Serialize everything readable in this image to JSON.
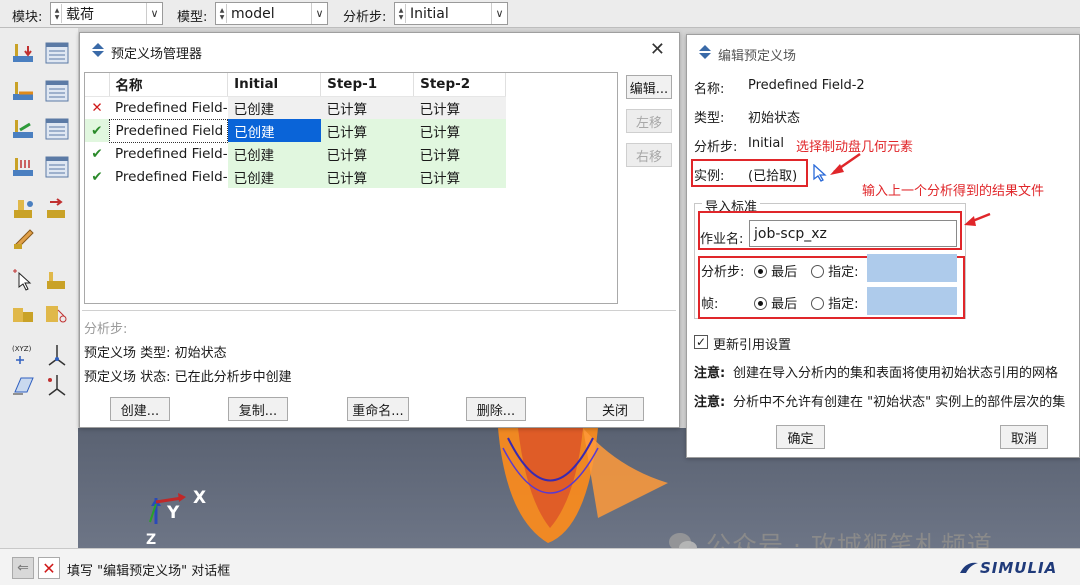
{
  "topbar": {
    "module_label": "模块:",
    "module_value": "载荷",
    "model_label": "模型:",
    "model_value": "model",
    "step_label": "分析步:",
    "step_value": "Initial"
  },
  "manager": {
    "title": "预定义场管理器",
    "columns": [
      "名称",
      "Initial",
      "Step-1",
      "Step-2"
    ],
    "rows": [
      {
        "status": "✕",
        "name": "Predefined Field-",
        "initial": "已创建",
        "step1": "已计算",
        "step2": "已计算"
      },
      {
        "status": "✔",
        "name": "Predefined Field",
        "initial": "已创建",
        "step1": "已计算",
        "step2": "已计算"
      },
      {
        "status": "✔",
        "name": "Predefined Field-",
        "initial": "已创建",
        "step1": "已计算",
        "step2": "已计算"
      },
      {
        "status": "✔",
        "name": "Predefined Field-",
        "initial": "已创建",
        "step1": "已计算",
        "step2": "已计算"
      }
    ],
    "side_buttons": {
      "edit": "编辑...",
      "left": "左移",
      "right": "右移"
    },
    "info_step_label": "分析步:",
    "info_type": "预定义场 类型: 初始状态",
    "info_status": "预定义场 状态: 已在此分析步中创建",
    "buttons": {
      "create": "创建...",
      "copy": "复制...",
      "rename": "重命名...",
      "delete": "删除...",
      "close": "关闭"
    }
  },
  "editor": {
    "title": "编辑预定义场",
    "name_label": "名称:",
    "name_value": "Predefined Field-2",
    "type_label": "类型:",
    "type_value": "初始状态",
    "step_label": "分析步:",
    "step_value": "Initial",
    "instance_label": "实例:",
    "instance_value": "(已拾取)",
    "group_title": "导入标准",
    "job_label": "作业名:",
    "job_value": "job-scp_xz",
    "step_row_label": "分析步:",
    "frame_row_label": "帧:",
    "last_label": "最后",
    "specify_label": "指定:",
    "update_label": "更新引用设置",
    "note1_label": "注意:",
    "note1_text": "创建在导入分析内的集和表面将使用初始状态引用的网格",
    "note2_label": "注意:",
    "note2_text": "分析中不允许有创建在 \"初始状态\" 实例上的部件层次的集",
    "ok": "确定",
    "cancel": "取消"
  },
  "annotations": {
    "pick_geometry": "选择制动盘几何元素",
    "input_result": "输入上一个分析得到的结果文件"
  },
  "status_prompt": "填写 \"编辑预定义场\" 对话框",
  "watermark": "公众号 · 攻城狮笔札频道",
  "triad": {
    "x": "X",
    "y": "Y",
    "z": "Z"
  },
  "brand": "SIMULIA",
  "colors": {
    "annotation_red": "#e0262a",
    "selected_blue": "#0a64d8",
    "row_green": "#e1f7df",
    "check_green": "#2a8a2a"
  }
}
